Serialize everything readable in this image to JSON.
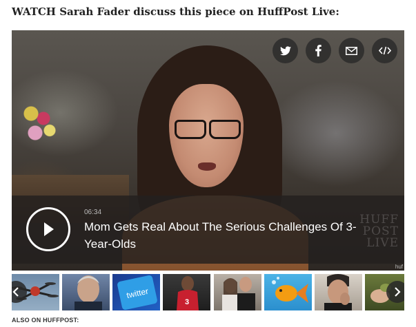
{
  "heading": "WATCH Sarah Fader discuss this piece on HuffPost Live:",
  "player": {
    "share_buttons": [
      {
        "icon": "twitter-icon"
      },
      {
        "icon": "facebook-icon"
      },
      {
        "icon": "email-icon"
      },
      {
        "icon": "embed-icon"
      }
    ],
    "duration": "06:34",
    "title": "Mom Gets Real About The Serious Challenges Of 3-Year-Olds",
    "logo_lines": [
      "HUFF",
      "POST",
      "LIVE"
    ],
    "corner_tag": "huf"
  },
  "carousel": {
    "thumbnails": [
      {
        "subject": "drone"
      },
      {
        "subject": "man-portrait"
      },
      {
        "subject": "twitter-logo",
        "label": "twitter"
      },
      {
        "subject": "basketball-player"
      },
      {
        "subject": "couple"
      },
      {
        "subject": "goldfish"
      },
      {
        "subject": "man-hand-on-face"
      },
      {
        "subject": "hand-holding-object"
      }
    ]
  },
  "footer": {
    "label": "ALSO ON HUFFPOST:"
  },
  "colors": {
    "caption_bg": "#231f1e",
    "share_button_bg": "#282828",
    "text_dark": "#222222"
  }
}
